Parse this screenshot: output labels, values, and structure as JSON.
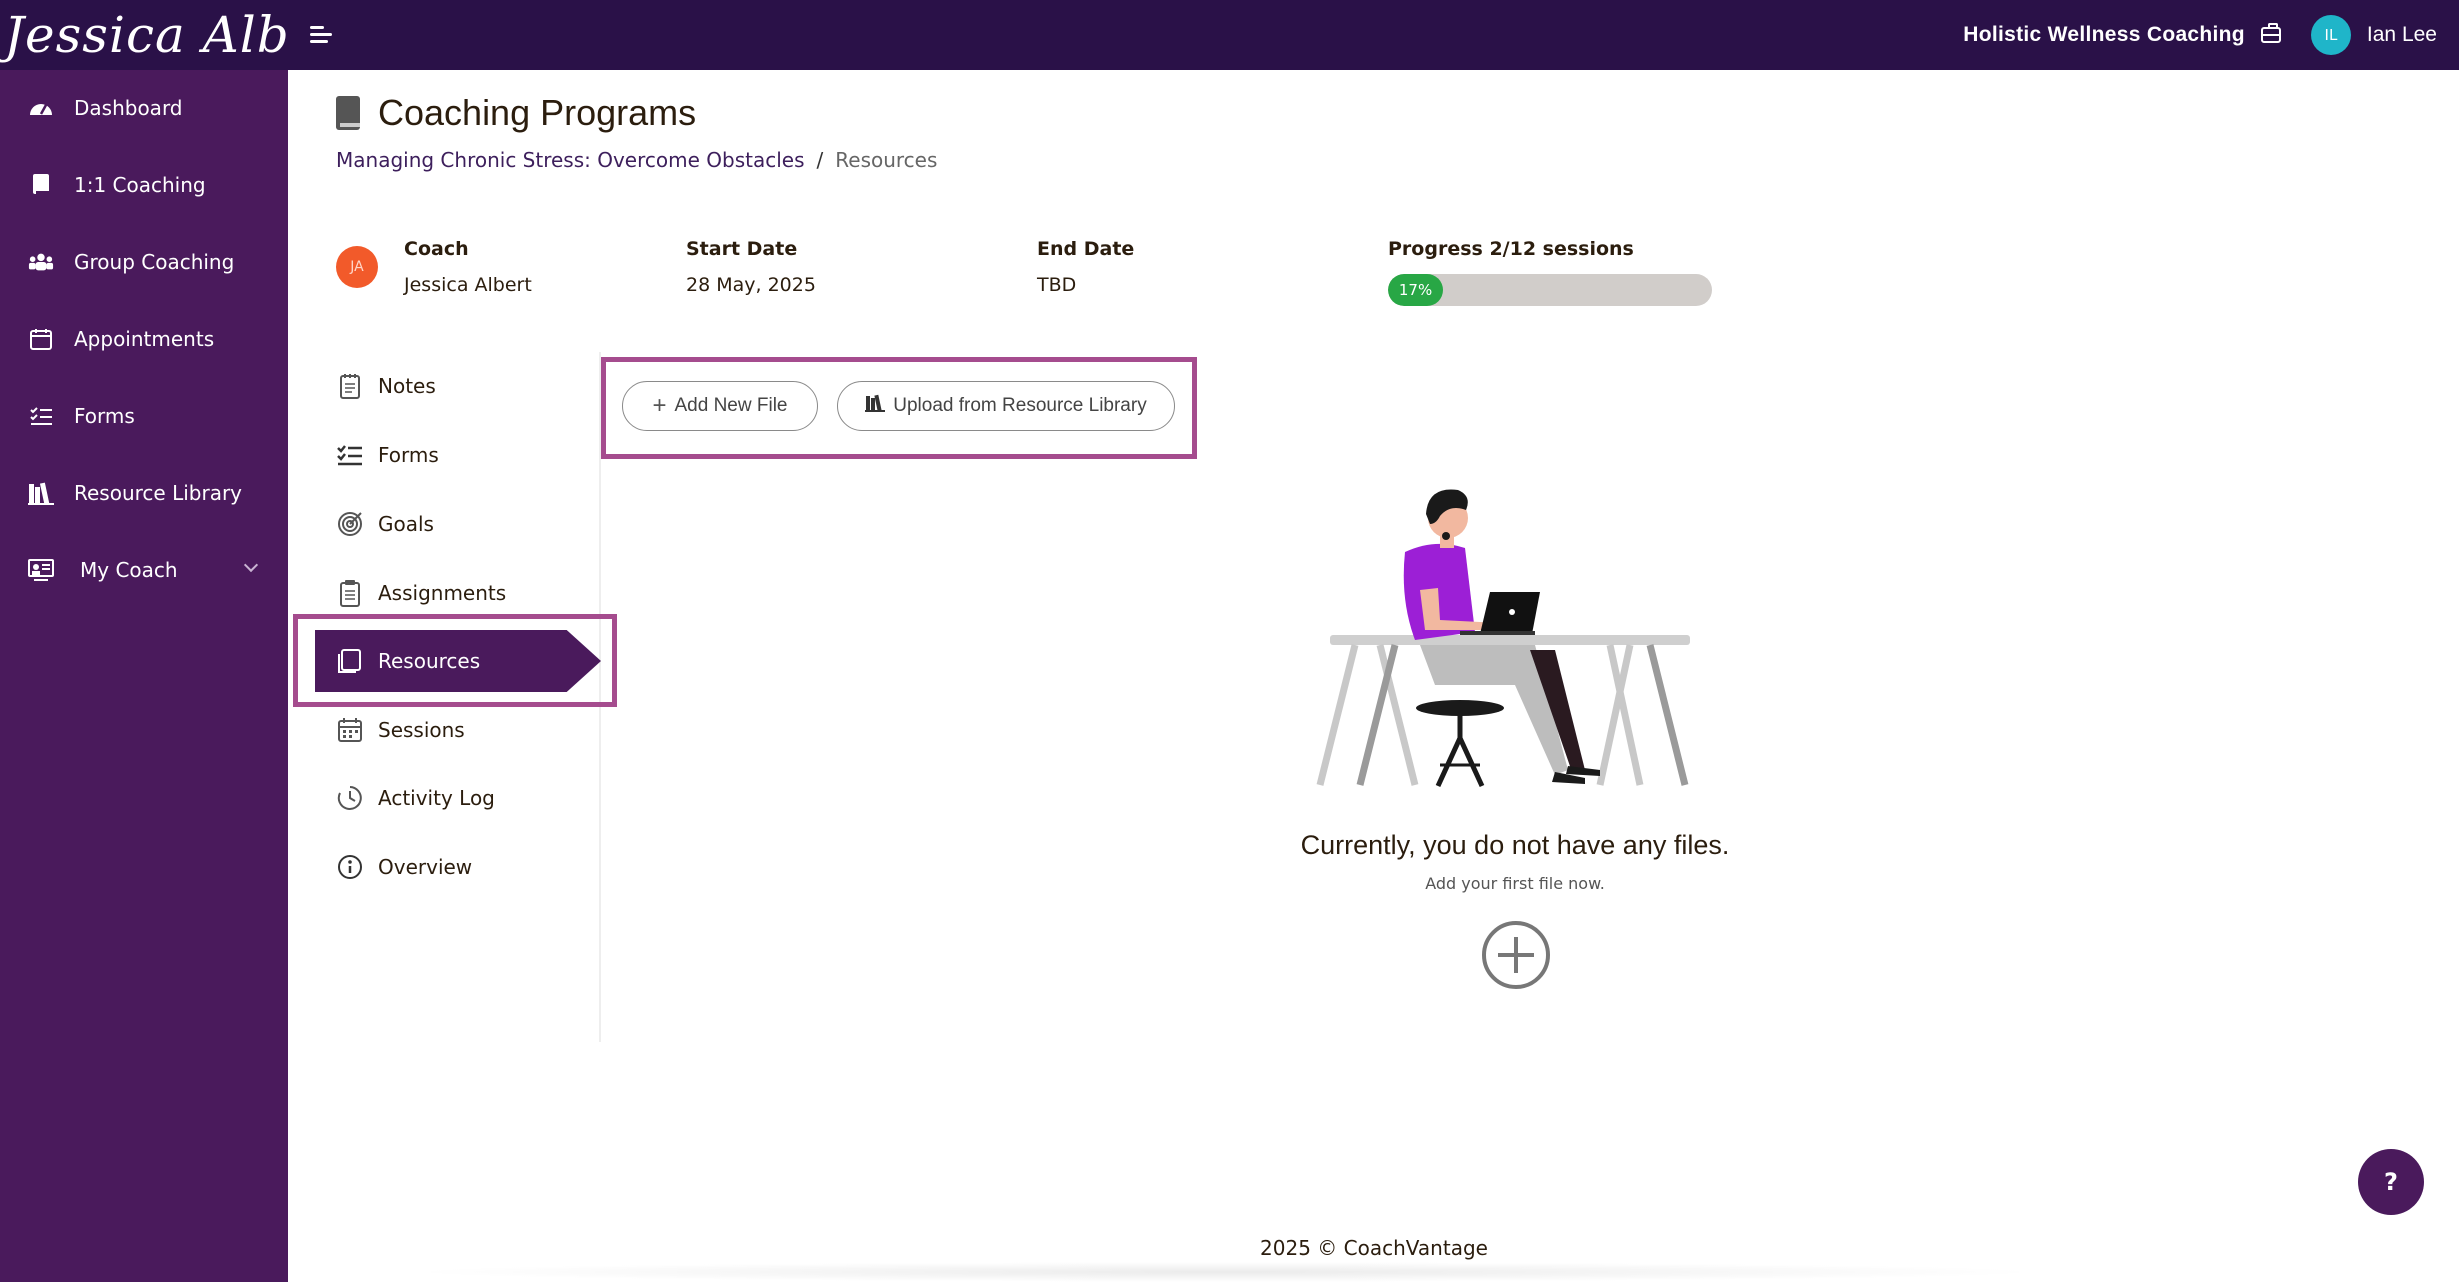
{
  "brand": {
    "logo_text": "Jessica Albert"
  },
  "header": {
    "org_name": "Holistic Wellness Coaching",
    "user_initials": "IL",
    "user_name": "Ian Lee"
  },
  "sidebar": {
    "items": [
      {
        "label": "Dashboard",
        "icon": "dashboard-icon"
      },
      {
        "label": "1:1 Coaching",
        "icon": "book-icon"
      },
      {
        "label": "Group Coaching",
        "icon": "group-icon"
      },
      {
        "label": "Appointments",
        "icon": "calendar-icon"
      },
      {
        "label": "Forms",
        "icon": "checklist-icon"
      },
      {
        "label": "Resource Library",
        "icon": "library-icon"
      },
      {
        "label": "My Coach",
        "icon": "coach-icon"
      }
    ]
  },
  "page": {
    "title": "Coaching Programs"
  },
  "breadcrumb": {
    "program": "Managing Chronic Stress: Overcome Obstacles",
    "separator": "/",
    "current": "Resources"
  },
  "program_info": {
    "coach_label": "Coach",
    "coach_initials": "JA",
    "coach_name": "Jessica Albert",
    "start_label": "Start Date",
    "start_value": "28 May, 2025",
    "end_label": "End Date",
    "end_value": "TBD",
    "progress_label": "Progress 2/12 sessions",
    "progress_percent_text": "17%",
    "progress_fraction": 0.17
  },
  "submenu": {
    "items": [
      {
        "label": "Notes",
        "icon": "notes-icon"
      },
      {
        "label": "Forms",
        "icon": "checklist-icon"
      },
      {
        "label": "Goals",
        "icon": "target-icon"
      },
      {
        "label": "Assignments",
        "icon": "clipboard-icon"
      },
      {
        "label": "Resources",
        "icon": "resources-icon",
        "active": true
      },
      {
        "label": "Sessions",
        "icon": "calendar-icon"
      },
      {
        "label": "Activity Log",
        "icon": "clock-icon"
      },
      {
        "label": "Overview",
        "icon": "info-icon"
      }
    ]
  },
  "toolbar": {
    "add_label": "Add New File",
    "upload_label": "Upload from Resource Library"
  },
  "empty_state": {
    "title": "Currently, you do not have any files.",
    "subtitle": "Add your first file now."
  },
  "footer": {
    "text": "2025 © CoachVantage"
  },
  "help": {
    "label": "?"
  },
  "colors": {
    "topbar": "#2a1148",
    "sidebar": "#4a1a5c",
    "highlight": "#a54c8e",
    "progress": "#28a745",
    "coach_avatar": "#f25a2a",
    "user_avatar": "#1fb5c9"
  }
}
